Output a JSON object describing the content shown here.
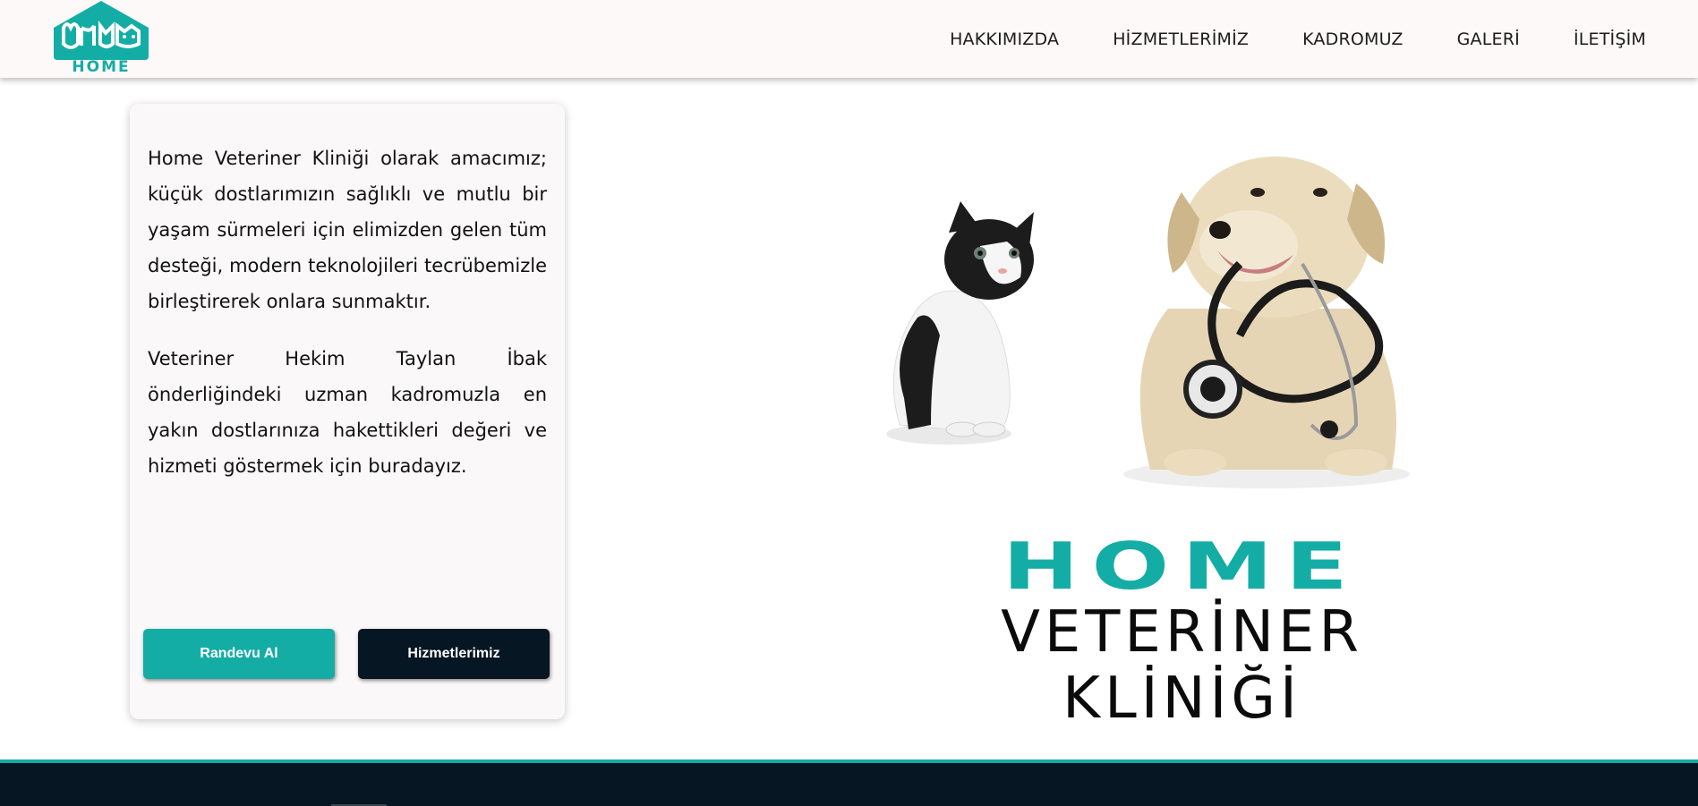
{
  "header": {
    "logo_text": "HOME",
    "nav": [
      {
        "label": "HAKKIMIZDA"
      },
      {
        "label": "HİZMETLERİMİZ"
      },
      {
        "label": "KADROMUZ"
      },
      {
        "label": "GALERİ"
      },
      {
        "label": "İLETİŞİM"
      }
    ]
  },
  "intro": {
    "paragraph_1": "Home Veteriner Kliniği olarak amacımız; küçük dostlarımızın sağlıklı ve mutlu bir yaşam sürmeleri için elimizden gelen tüm desteği, modern teknolojileri tecrübemizle birleştirerek onlara sunmaktır.",
    "paragraph_2": "Veteriner Hekim Taylan İbak önderliğindeki uzman kadromuzla en yakın dostlarınıza hakettikleri değeri ve hizmeti göstermek için buradayız.",
    "primary_button": "Randevu Al",
    "secondary_button": "Hizmetlerimiz"
  },
  "hero": {
    "brand_title": "HOME",
    "brand_subtitle": "VETERİNER KLİNİĞİ"
  },
  "colors": {
    "accent": "#14ada6",
    "dark": "#071623",
    "header_bg": "#fdf9f8"
  },
  "icons": [
    "home-logo-icon",
    "kitten-illustration",
    "puppy-with-stethoscope-illustration"
  ]
}
